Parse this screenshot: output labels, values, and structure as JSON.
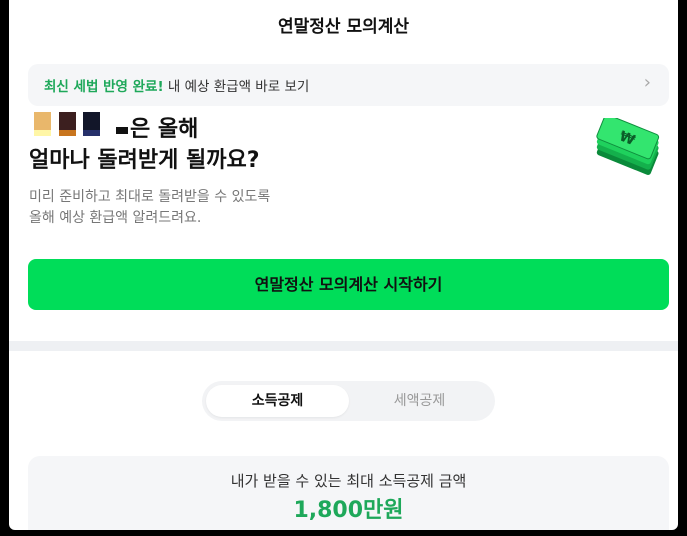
{
  "header": {
    "title": "연말정산 모의계산"
  },
  "banner": {
    "highlight": "최신 세법 반영 완료!",
    "text": " 내 예상 환급액 바로 보기",
    "chevron": "›"
  },
  "hero": {
    "line1": "은 올해",
    "line2": "얼마나 돌려받게 될까요?",
    "sub1": "미리 준비하고 최대로 돌려받을 수 있도록",
    "sub2": "올해 예상 환급액 알려드려요.",
    "icon": "money-bills-icon"
  },
  "cta": {
    "label": "연말정산 모의계산 시작하기"
  },
  "tabs": [
    {
      "label": "소득공제",
      "active": true
    },
    {
      "label": "세액공제",
      "active": false
    }
  ],
  "summary": {
    "label": "내가 받을 수 있는 최대 소득공제 금액",
    "amount": "1,800만원"
  },
  "colors": {
    "accent": "#00dd59",
    "green_text": "#1ea85a"
  }
}
